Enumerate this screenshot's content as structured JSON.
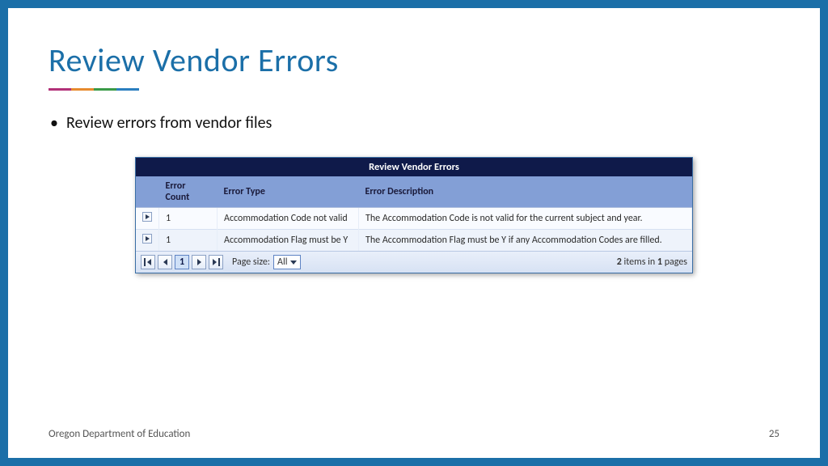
{
  "title": "Review Vendor Errors",
  "bullet": "Review errors from vendor files",
  "panel": {
    "header": "Review Vendor Errors",
    "columns": {
      "count": "Error Count",
      "type": "Error Type",
      "desc": "Error Description"
    },
    "rows": [
      {
        "count": "1",
        "type": "Accommodation Code not valid",
        "desc": "The Accommodation Code is not valid for the current subject and year."
      },
      {
        "count": "1",
        "type": "Accommodation Flag must be Y",
        "desc": "The Accommodation Flag must be Y if any Accommodation Codes are filled."
      }
    ],
    "pager": {
      "current_page": "1",
      "page_size_label": "Page size:",
      "page_size_value": "All",
      "status_items": "2",
      "status_mid": " items in ",
      "status_pages": "1",
      "status_tail": " pages"
    }
  },
  "footer": {
    "org": "Oregon Department of Education",
    "page_number": "25"
  }
}
